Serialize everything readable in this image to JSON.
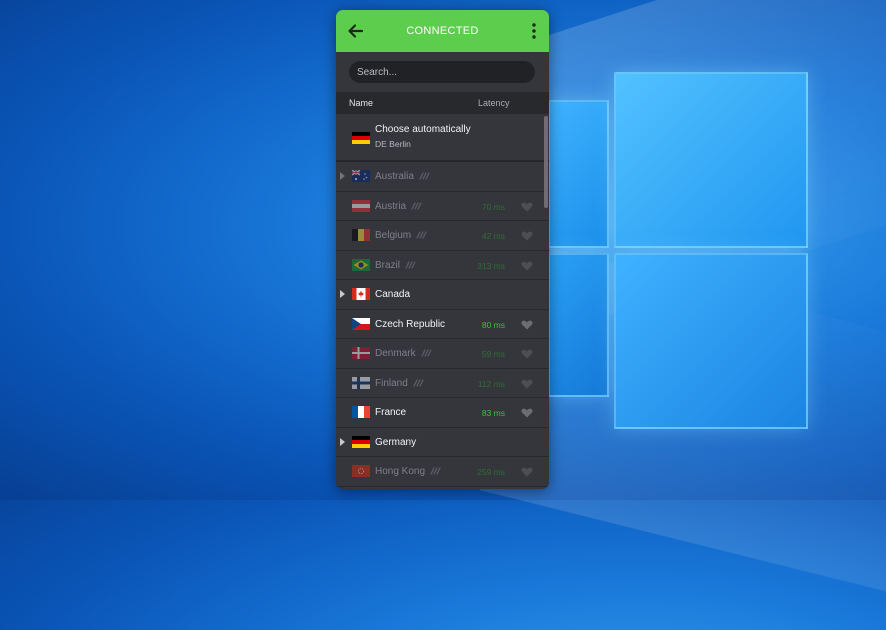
{
  "app": {
    "status_title": "CONNECTED",
    "accent_color": "#5ccd4c",
    "icons": {
      "back": "arrow-left-icon",
      "menu": "more-vertical-icon"
    }
  },
  "search": {
    "placeholder": "Search..."
  },
  "columns": {
    "name": "Name",
    "latency": "Latency"
  },
  "auto": {
    "title": "Choose automatically",
    "subtitle": "DE Berlin",
    "flag": "de"
  },
  "countries": [
    {
      "name": "Australia",
      "flag": "au",
      "latency": "",
      "expandable": true,
      "dim": true,
      "signal": true,
      "favorite": false
    },
    {
      "name": "Austria",
      "flag": "at",
      "latency": "70 ms",
      "expandable": false,
      "dim": true,
      "signal": true,
      "favorite": true
    },
    {
      "name": "Belgium",
      "flag": "be",
      "latency": "42 ms",
      "expandable": false,
      "dim": true,
      "signal": true,
      "favorite": true
    },
    {
      "name": "Brazil",
      "flag": "br",
      "latency": "313 ms",
      "expandable": false,
      "dim": true,
      "signal": true,
      "favorite": true
    },
    {
      "name": "Canada",
      "flag": "ca",
      "latency": "",
      "expandable": true,
      "dim": false,
      "signal": false,
      "favorite": false
    },
    {
      "name": "Czech Republic",
      "flag": "cz",
      "latency": "80 ms",
      "expandable": false,
      "dim": false,
      "signal": false,
      "favorite": true
    },
    {
      "name": "Denmark",
      "flag": "dk",
      "latency": "59 ms",
      "expandable": false,
      "dim": true,
      "signal": true,
      "favorite": true
    },
    {
      "name": "Finland",
      "flag": "fi",
      "latency": "112 ms",
      "expandable": false,
      "dim": true,
      "signal": true,
      "favorite": true
    },
    {
      "name": "France",
      "flag": "fr",
      "latency": "83 ms",
      "expandable": false,
      "dim": false,
      "signal": false,
      "favorite": true
    },
    {
      "name": "Germany",
      "flag": "de",
      "latency": "",
      "expandable": true,
      "dim": false,
      "signal": false,
      "favorite": false
    },
    {
      "name": "Hong Kong",
      "flag": "hk",
      "latency": "259 ms",
      "expandable": false,
      "dim": true,
      "signal": true,
      "favorite": true
    }
  ]
}
